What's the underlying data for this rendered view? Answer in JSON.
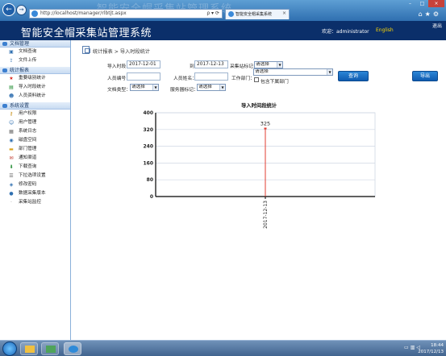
{
  "browser": {
    "url": "http://localhost/manager/rlbtjt.aspx",
    "tab_title": "智能安全帽采集系统",
    "window_title_faint": "智能安全帽采集站管理系统"
  },
  "header": {
    "title": "智能安全帽采集站管理系统",
    "welcome": "欢迎：administrator",
    "lang": "English",
    "logout": "退出"
  },
  "sidebar": {
    "sections": [
      {
        "label": "文档管理",
        "items": [
          {
            "label": "文档查询",
            "icon": "search-icon"
          },
          {
            "label": "文件上传",
            "icon": "upload-icon"
          }
        ]
      },
      {
        "label": "统计报表",
        "items": [
          {
            "label": "重要级别统计",
            "icon": "star-icon"
          },
          {
            "label": "导入时段统计",
            "icon": "import-icon"
          },
          {
            "label": "人员资料统计",
            "icon": "people-icon"
          }
        ]
      },
      {
        "label": "系统设置",
        "items": [
          {
            "label": "用户权限",
            "icon": "key-icon"
          },
          {
            "label": "用户管理",
            "icon": "user-icon"
          },
          {
            "label": "系统日志",
            "icon": "log-icon"
          },
          {
            "label": "磁盘空间",
            "icon": "disk-icon"
          },
          {
            "label": "部门管理",
            "icon": "folder-icon"
          },
          {
            "label": "通知渠道",
            "icon": "notice-icon"
          },
          {
            "label": "下载查询",
            "icon": "download-icon"
          },
          {
            "label": "下拉选项设置",
            "icon": "list-icon"
          },
          {
            "label": "修改密码",
            "icon": "password-icon"
          },
          {
            "label": "数据采集版本",
            "icon": "version-icon"
          },
          {
            "label": "采集站监控",
            "icon": "monitor-icon"
          }
        ]
      }
    ]
  },
  "breadcrumb": "统计报表 > 导入时段统计",
  "filters": {
    "import_time_label": "导入时段：",
    "date_from": "2017-12-01",
    "to_label": "到",
    "date_to": "2017-12-13",
    "station_label": "采集站标记：",
    "station_value": "请选择",
    "dept_label": "工作部门：",
    "dept_value": "请选择",
    "include_sub_label": "包含下属部门",
    "person_id_label": "人员编号：",
    "person_id_value": "",
    "person_name_label": "人员姓名：",
    "person_name_value": "",
    "file_type_label": "文档类型：",
    "file_type_value": "请选择",
    "server_label": "服务器标记：",
    "server_value": "请选择",
    "query_button": "查询",
    "export_button": "导出"
  },
  "chart_data": {
    "type": "bar",
    "title": "导入时间段统计",
    "categories": [
      "2017-12-13"
    ],
    "values": [
      325
    ],
    "ylim": [
      0,
      400
    ],
    "yticks": [
      0,
      80,
      160,
      240,
      320,
      400
    ],
    "grid": true,
    "colors": {
      "bar": "#e03c31",
      "grid": "#cfd7e3",
      "axis": "#000000",
      "label": "#222222"
    }
  },
  "taskbar": {
    "time": "18:44",
    "date": "2017/12/13"
  }
}
